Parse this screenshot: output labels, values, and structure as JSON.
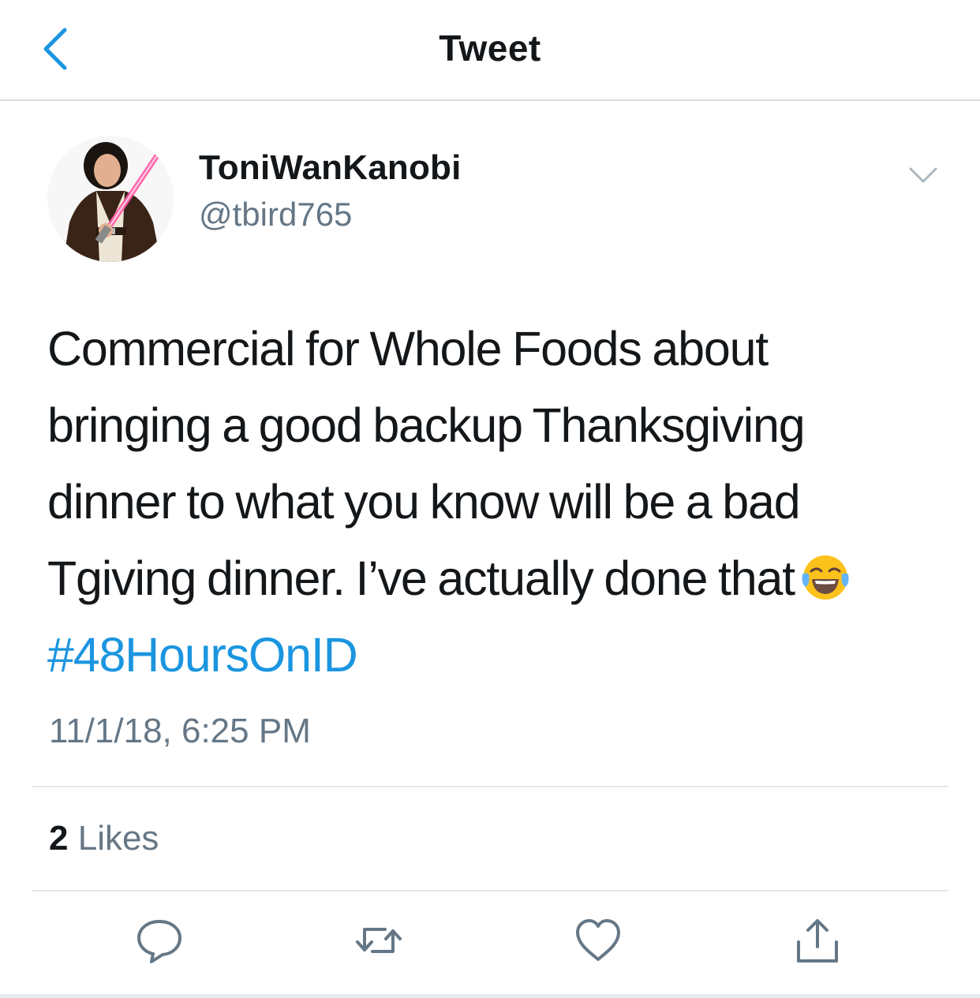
{
  "nav": {
    "title": "Tweet",
    "back_icon": "chevron-left-icon"
  },
  "author": {
    "display_name": "ToniWanKanobi",
    "handle": "@tbird765",
    "avatar_icon": "avatar-jedi-costume"
  },
  "tweet": {
    "text": "Commercial for Whole Foods about bringing a good backup Thanksgiving dinner to what you know will be a bad Tgiving dinner. I’ve actually done that",
    "emoji": "face-with-tears-of-joy",
    "hashtag": "#48HoursOnID",
    "timestamp": "11/1/18, 6:25 PM"
  },
  "stats": {
    "likes_count": "2",
    "likes_label": "Likes"
  },
  "actions": [
    "reply-icon",
    "retweet-icon",
    "like-icon",
    "share-icon"
  ],
  "colors": {
    "accent": "#1b95e0",
    "secondary_text": "#657786",
    "primary_text": "#14171a",
    "divider": "#e1e8ed"
  }
}
